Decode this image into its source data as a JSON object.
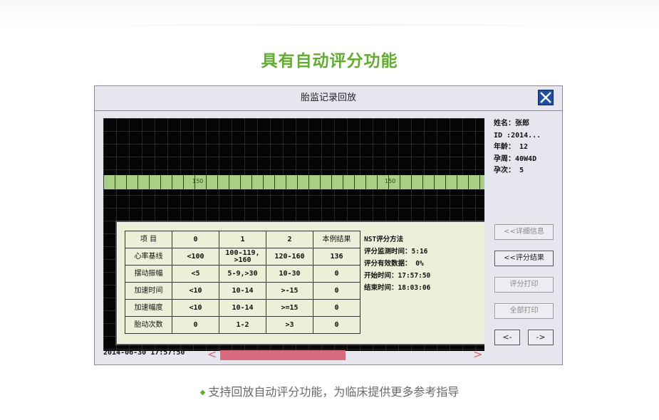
{
  "heading": "具有自动评分功能",
  "window": {
    "title": "胎监记录回放",
    "close_icon": "close-icon"
  },
  "graph": {
    "band_labels": [
      "150",
      "150"
    ],
    "timestamp": "2014-06-30  17:57:50",
    "scroll_left_glyph": "<",
    "scroll_right_glyph": ">",
    "scroll_position": 0.5
  },
  "patient": {
    "name": "姓名：张郎",
    "id": "ID :2014...",
    "age": "年龄： 12",
    "gestation": "孕周：40W4D",
    "pregnancy_count": "孕次： 5"
  },
  "buttons": {
    "details": "<<详细信息",
    "score_result": "<<评分结果",
    "score_print": "评分打印",
    "print_all": "全部打印",
    "prev": "<-",
    "next": "->"
  },
  "score_table": {
    "headers": [
      "项  目",
      "0",
      "1",
      "2",
      "本例结果"
    ],
    "rows": [
      [
        "心率基线",
        "<100",
        "100-119,\n>160",
        "120-160",
        "136"
      ],
      [
        "摆动振幅",
        "<5",
        "5-9,>30",
        "10-30",
        "0"
      ],
      [
        "加速时间",
        "<10",
        "10-14",
        ">-15",
        "0"
      ],
      [
        "加速幅度",
        "<10",
        "10-14",
        ">=15",
        "0"
      ],
      [
        "胎动次数",
        "0",
        "1-2",
        ">3",
        "0"
      ]
    ]
  },
  "nst": {
    "title": "NST评分方法",
    "monitor_time": "评分监测时间：5:16",
    "valid_data": "评分有效数据：   0%",
    "start_time": "开始时间：17:57:50",
    "end_time": "结束时间：18:03:06"
  },
  "footer": {
    "bullet": "◆",
    "text": "支持回放自动评分功能，为临床提供更多参考指导"
  },
  "colors": {
    "accent_green": "#5fae2e",
    "scroll_thumb": "#d96a7e",
    "close_blue": "#1d4fa8",
    "trace_band": "#a9cf86"
  }
}
